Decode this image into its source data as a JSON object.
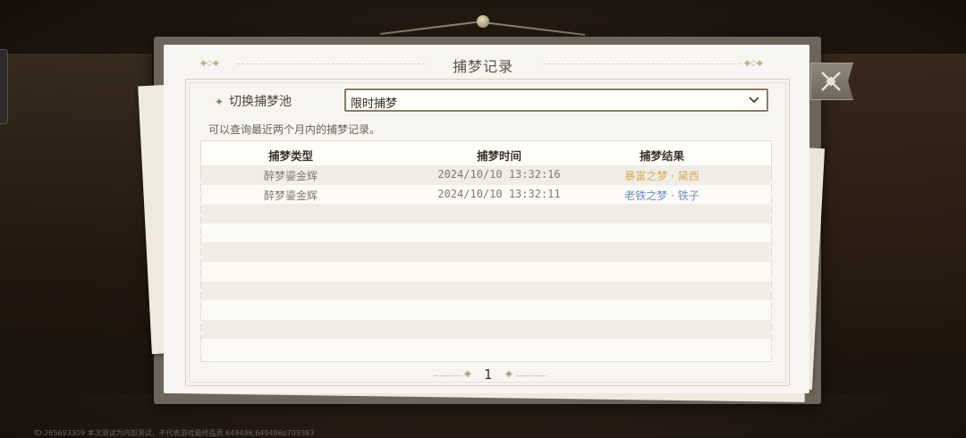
{
  "window": {
    "title": "捕梦记录"
  },
  "selector": {
    "label": "切换捕梦池",
    "selected": "限时捕梦"
  },
  "hint": "可以查询最近两个月内的捕梦记录。",
  "table": {
    "headers": [
      "捕梦类型",
      "捕梦时间",
      "捕梦结果"
    ],
    "rows": [
      {
        "type": "醉梦鎏金辉",
        "time": "2024/10/10 13:32:16",
        "result": "暴富之梦 · 黛西",
        "result_color": "#d9a956"
      },
      {
        "type": "醉梦鎏金辉",
        "time": "2024/10/10 13:32:11",
        "result": "老铁之梦 · 铁子",
        "result_color": "#6c8fbd"
      }
    ]
  },
  "pagination": {
    "current_page": "1"
  },
  "footer": "ID:265693309 本次测试为内部测试，不代表游戏最终品质 649486,649486p709383",
  "icons": {
    "close": "close-x-icon",
    "dropdown": "chevron-down-icon",
    "selector_marker": "star-icon"
  }
}
